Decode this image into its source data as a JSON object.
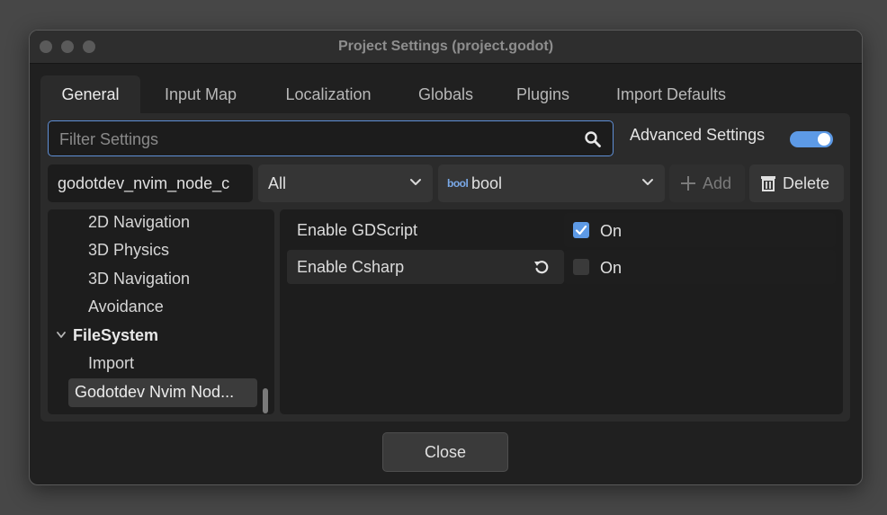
{
  "window": {
    "title": "Project Settings (project.godot)"
  },
  "tabs": [
    {
      "label": "General",
      "active": true
    },
    {
      "label": "Input Map",
      "active": false
    },
    {
      "label": "Localization",
      "active": false
    },
    {
      "label": "Globals",
      "active": false
    },
    {
      "label": "Plugins",
      "active": false
    },
    {
      "label": "Import Defaults",
      "active": false
    }
  ],
  "filter": {
    "placeholder": "Filter Settings",
    "value": ""
  },
  "advanced": {
    "label": "Advanced Settings",
    "enabled": true
  },
  "add_property": {
    "name_value": "godotdev_nvim_node_c",
    "scope": "All",
    "type_icon": "bool",
    "type": "bool",
    "add_label": "Add",
    "delete_label": "Delete"
  },
  "tree": {
    "items": [
      {
        "label": "2D Navigation"
      },
      {
        "label": "3D Physics"
      },
      {
        "label": "3D Navigation"
      },
      {
        "label": "Avoidance"
      },
      {
        "label": "FileSystem",
        "expanded": true
      },
      {
        "label": "Import"
      },
      {
        "label": "Godotdev Nvim Nod...",
        "selected": true
      }
    ]
  },
  "properties": [
    {
      "name": "Enable GDScript",
      "checked": true,
      "value_label": "On",
      "revertable": false
    },
    {
      "name": "Enable Csharp",
      "checked": false,
      "value_label": "On",
      "revertable": true
    }
  ],
  "footer": {
    "close_label": "Close"
  },
  "colors": {
    "accent": "#5d9ae6",
    "window_bg": "#202020",
    "panel_bg": "#2b2b2b"
  }
}
